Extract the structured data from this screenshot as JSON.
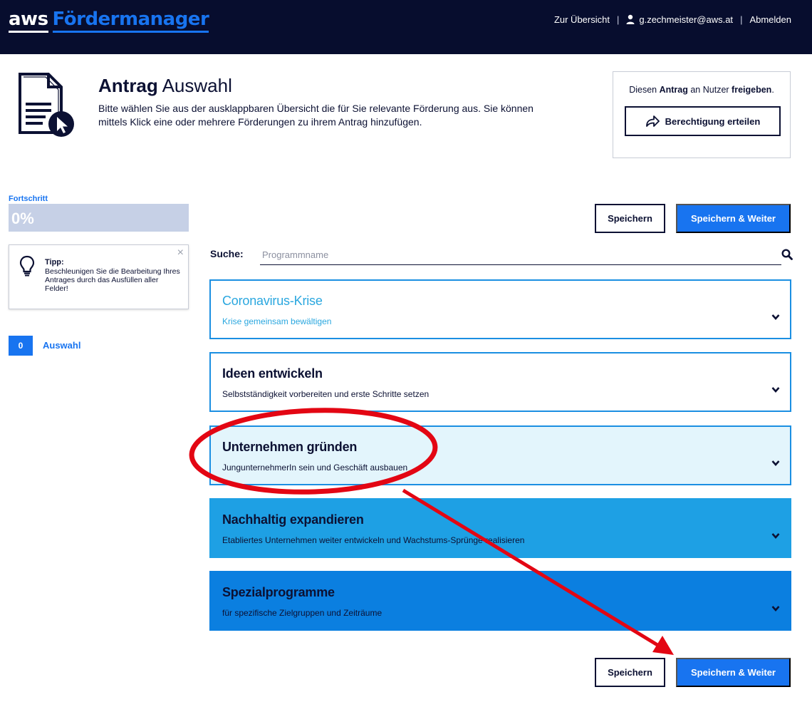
{
  "header": {
    "logo_aws": "aws",
    "logo_name": "Fördermanager",
    "nav_overview": "Zur Übersicht",
    "nav_separator": "|",
    "user_email": "g.zechmeister@aws.at",
    "logout": "Abmelden"
  },
  "page": {
    "title_bold": "Antrag",
    "title_rest": "Auswahl",
    "description": "Bitte wählen Sie aus der ausklappbaren Übersicht die für Sie relevante Förderung aus. Sie können mittels Klick eine oder mehrere Förderungen zu ihrem Antrag hinzufügen."
  },
  "share": {
    "text_prefix": "Diesen",
    "text_bold1": "Antrag",
    "text_mid": "an Nutzer",
    "text_bold2": "freigeben",
    "text_suffix": ".",
    "button_label": "Berechtigung erteilen"
  },
  "progress": {
    "label": "Fortschritt",
    "value_text": "0%",
    "fraction": 0
  },
  "tip": {
    "title": "Tipp:",
    "text": "Beschleunigen Sie die Bearbeitung Ihres Antrages durch das Ausfüllen aller Felder!",
    "close": "×"
  },
  "steps": [
    {
      "number": "0",
      "label": "Auswahl"
    }
  ],
  "actions": {
    "save": "Speichern",
    "save_next": "Speichern & Weiter"
  },
  "search": {
    "label": "Suche:",
    "placeholder": "Programmname",
    "value": ""
  },
  "categories": [
    {
      "title": "Coronavirus-Krise",
      "subtitle": "Krise gemeinsam bewältigen"
    },
    {
      "title": "Ideen entwickeln",
      "subtitle": "Selbstständigkeit vorbereiten und erste Schritte setzen"
    },
    {
      "title": "Unternehmen gründen",
      "subtitle": "JungunternehmerIn sein und Geschäft ausbauen"
    },
    {
      "title": "Nachhaltig expandieren",
      "subtitle": "Etabliertes Unternehmen weiter entwickeln und Wachstums-Sprünge realisieren"
    },
    {
      "title": "Spezialprogramme",
      "subtitle": "für spezifische Zielgruppen und Zeiträume"
    }
  ],
  "colors": {
    "navy": "#070d2e",
    "brand_blue": "#1874f0",
    "annotation_red": "#e30613"
  }
}
